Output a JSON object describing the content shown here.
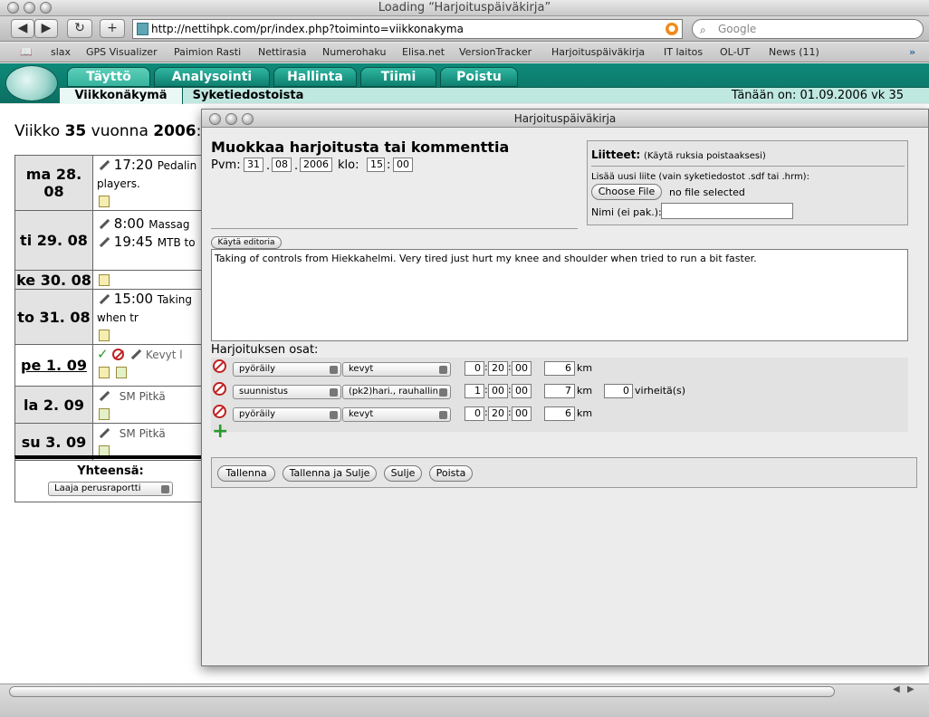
{
  "browser": {
    "title": "Loading “Harjoituspäiväkirja”",
    "url": "http://nettihpk.com/pr/index.php?toiminto=viikkonakyma",
    "search_placeholder": "Google",
    "bookmarks": [
      "slax",
      "GPS Visualizer",
      "Paimion Rasti",
      "Nettirasia",
      "Numerohaku",
      "Elisa.net",
      "VersionTracker",
      "Harjoituspäiväkirja",
      "IT laitos",
      "OL-UT",
      "News (11)"
    ]
  },
  "app": {
    "tabs": [
      "Täyttö",
      "Analysointi",
      "Hallinta",
      "Tiimi",
      "Poistu"
    ],
    "subtabs": [
      "Viikkonäkymä",
      "Syketiedostoista"
    ],
    "today": "Tänään on: 01.09.2006 vk 35",
    "week_title_prefix": "Viikko",
    "week_number": "35",
    "week_title_mid": "vuonna",
    "week_year": "2006",
    "week_title_suffix": ":"
  },
  "calendar": {
    "days": [
      {
        "label": "ma 28. 08",
        "entries": [
          {
            "time": "17:20",
            "text": "Pedalin players."
          }
        ]
      },
      {
        "label": "ti 29. 08",
        "entries": [
          {
            "time": "8:00",
            "text": "Massag"
          },
          {
            "time": "19:45",
            "text": "MTB to"
          }
        ]
      },
      {
        "label": "ke 30. 08",
        "entries": []
      },
      {
        "label": "to 31. 08",
        "entries": [
          {
            "time": "15:00",
            "text": "Taking when tr"
          }
        ]
      },
      {
        "label": "pe 1. 09",
        "entries": [
          {
            "time": "",
            "text": "Kevyt l"
          }
        ]
      },
      {
        "label": "la 2. 09",
        "entries": [
          {
            "time": "",
            "text": "SM Pitkä"
          }
        ]
      },
      {
        "label": "su 3. 09",
        "entries": [
          {
            "time": "",
            "text": "SM Pitkä"
          }
        ]
      }
    ],
    "totals_label": "Yhteensä:",
    "report_select": "Laaja perusraportti"
  },
  "modal": {
    "window_title": "Harjoituspäiväkirja",
    "heading": "Muokkaa harjoitusta tai kommenttia",
    "date_label": "Pvm:",
    "day": "31",
    "month": "08",
    "year": "2006",
    "time_label": "klo:",
    "hour": "15",
    "minute": "00",
    "attachments_title": "Liitteet:",
    "attachments_hint": "(Käytä ruksia poistaaksesi)",
    "add_attachment": "Lisää uusi liite (vain syketiedostot .sdf tai .hrm):",
    "choose_file": "Choose File",
    "no_file": "no file selected",
    "name_label": "Nimi (ei pak.):",
    "editor_button": "Käytä editoria",
    "comment": "Taking of controls from Hiekkahelmi. Very tired just hurt my knee and shoulder when tried to run a bit faster.",
    "parts_label": "Harjoituksen osat:",
    "parts": [
      {
        "sport": "pyöräily",
        "type": "kevyt",
        "h": "0",
        "m": "20",
        "s": "00",
        "km": "6",
        "km_label": "km",
        "errors": null,
        "errors_label": ""
      },
      {
        "sport": "suunnistus",
        "type": "(pk2)hari., rauhallin",
        "h": "1",
        "m": "00",
        "s": "00",
        "km": "7",
        "km_label": "km",
        "errors": "0",
        "errors_label": "virheitä(s)"
      },
      {
        "sport": "pyöräily",
        "type": "kevyt",
        "h": "0",
        "m": "20",
        "s": "00",
        "km": "6",
        "km_label": "km",
        "errors": null,
        "errors_label": ""
      }
    ],
    "buttons": [
      "Tallenna",
      "Tallenna ja Sulje",
      "Sulje",
      "Poista"
    ]
  }
}
